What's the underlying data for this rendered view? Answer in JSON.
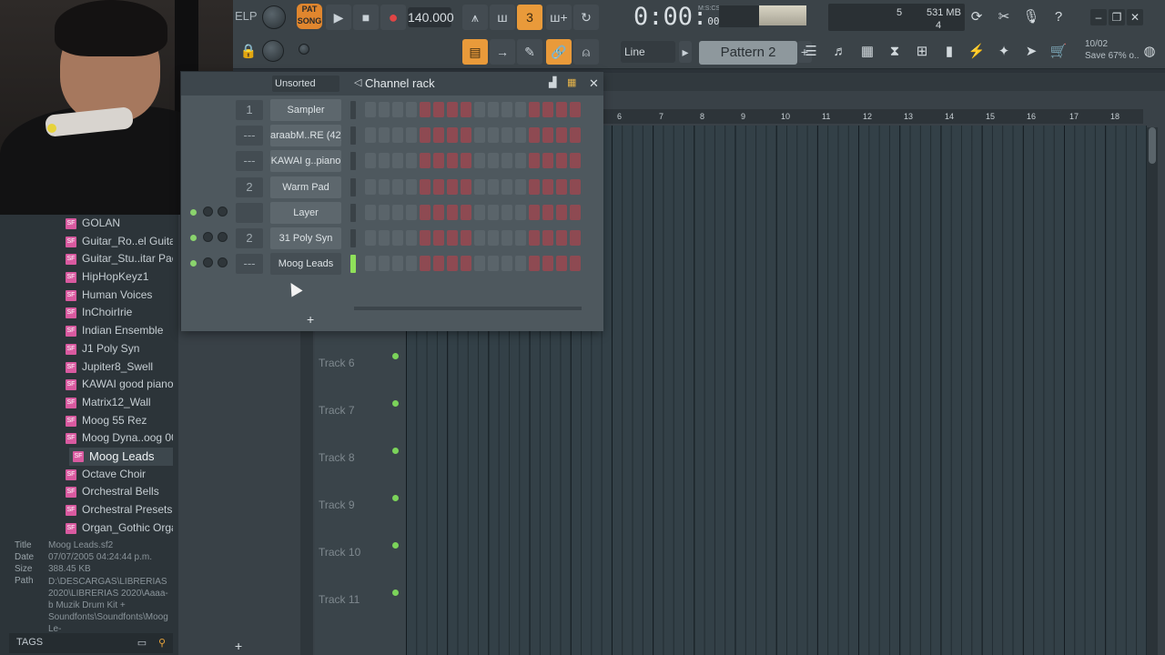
{
  "toolbar": {
    "help_label": "ELP",
    "pat_label": "PAT",
    "song_label": "SONG",
    "tempo": "140.000",
    "time_main": "0:00",
    "time_sub": "00",
    "time_unit": "M:S:CS",
    "cpu_voices": "5",
    "cpu_mem": "531 MB",
    "cpu_poly": "4",
    "snap": "Line",
    "pattern": "Pattern 2",
    "news_date": "10/02",
    "news_text": "Save 67% o.."
  },
  "browser": {
    "items": [
      "GOLAN",
      "Guitar_Ro..el Guitar",
      "Guitar_Stu..itar Pack",
      "HipHopKeyz1",
      "Human Voices",
      "InChoirIrie",
      "Indian Ensemble",
      "J1 Poly Syn",
      "Jupiter8_Swell",
      "KAWAI good piano",
      "Matrix12_Wall",
      "Moog 55 Rez",
      "Moog Dyna..oog 001",
      "Moog Leads",
      "Octave Choir",
      "Orchestral Bells",
      "Orchestral Presets",
      "Organ_Gothic Organ"
    ],
    "selected": "Moog Leads",
    "info": {
      "title_k": "Title",
      "title_v": "Moog Leads.sf2",
      "date_k": "Date",
      "date_v": "07/07/2005 04:24:44 p.m.",
      "size_k": "Size",
      "size_v": "388.45 KB",
      "path_k": "Path",
      "path_v": "D:\\DESCARGAS\\LIBRERIAS 2020\\LIBRERIAS 2020\\Aaaa-b Muzik Drum Kit + Soundfonts\\Soundfonts\\Moog Le-"
    },
    "tags_label": "TAGS"
  },
  "channel_rack": {
    "filter": "Unsorted",
    "title": "Channel rack",
    "channels": [
      {
        "num": "1",
        "name": "Sampler"
      },
      {
        "num": "---",
        "name": "araabM..RE (42)"
      },
      {
        "num": "---",
        "name": "KAWAI g..piano"
      },
      {
        "num": "2",
        "name": "Warm Pad"
      },
      {
        "num": "",
        "name": "Layer"
      },
      {
        "num": "2",
        "name": "31 Poly Syn"
      },
      {
        "num": "---",
        "name": "Moog Leads"
      }
    ],
    "add_label": "+"
  },
  "playlist": {
    "ruler": [
      "6",
      "7",
      "8",
      "9",
      "10",
      "11",
      "12",
      "13",
      "14",
      "15",
      "16",
      "17",
      "18"
    ],
    "tracks": [
      "Track 6",
      "Track 7",
      "Track 8",
      "Track 9",
      "Track 10",
      "Track 11"
    ],
    "add_label": "+"
  }
}
